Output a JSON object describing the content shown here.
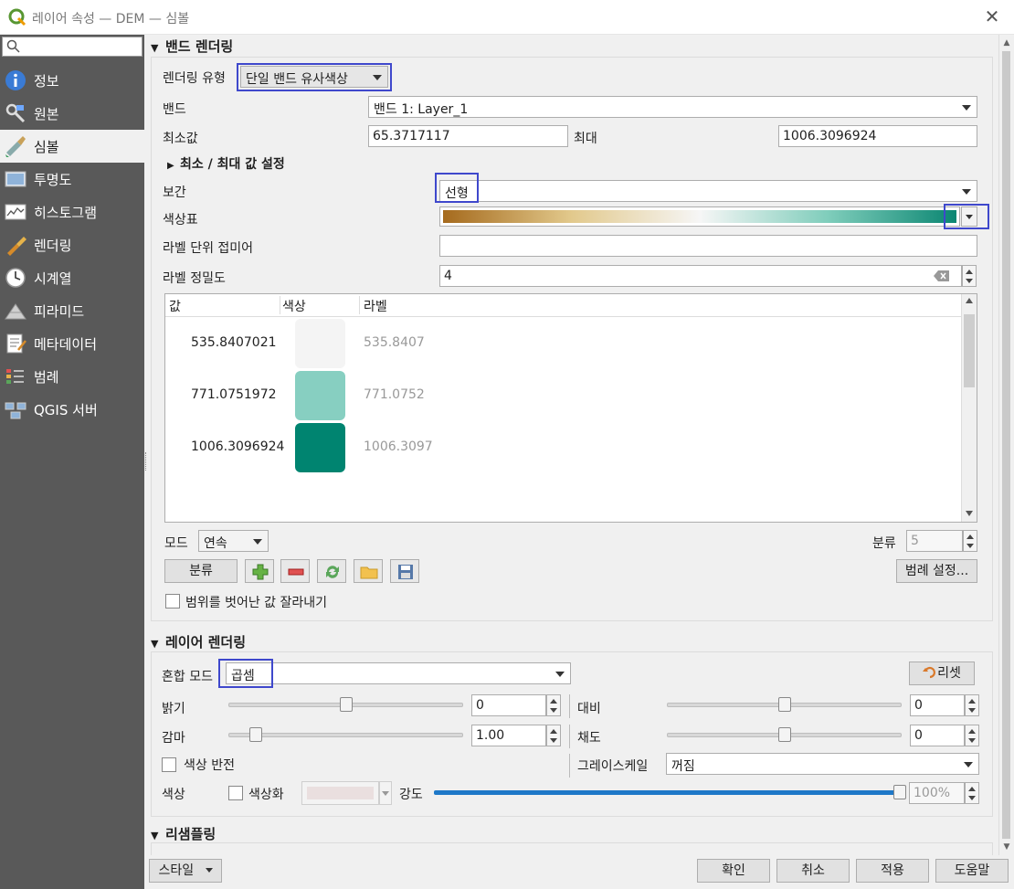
{
  "window": {
    "title": "레이어 속성 — DEM — 심볼",
    "close_glyph": "✕"
  },
  "search": {
    "placeholder": ""
  },
  "sidebar": {
    "items": [
      {
        "label": "정보",
        "icon": "info-icon"
      },
      {
        "label": "원본",
        "icon": "source-icon"
      },
      {
        "label": "심볼",
        "icon": "symbology-icon",
        "active": true
      },
      {
        "label": "투명도",
        "icon": "transparency-icon"
      },
      {
        "label": "히스토그램",
        "icon": "histogram-icon"
      },
      {
        "label": "렌더링",
        "icon": "rendering-icon"
      },
      {
        "label": "시계열",
        "icon": "temporal-icon"
      },
      {
        "label": "피라미드",
        "icon": "pyramids-icon"
      },
      {
        "label": "메타데이터",
        "icon": "metadata-icon"
      },
      {
        "label": "범례",
        "icon": "legend-icon"
      },
      {
        "label": "QGIS 서버",
        "icon": "qgis-server-icon"
      }
    ]
  },
  "band_rendering": {
    "title": "밴드 렌더링",
    "render_type_label": "렌더링 유형",
    "render_type_value": "단일 밴드 유사색상",
    "band_label": "밴드",
    "band_value": "밴드 1: Layer_1",
    "min_label": "최소값",
    "min_value": "65.3717117",
    "max_label": "최대",
    "max_value": "1006.3096924",
    "minmax_settings_label": "최소 / 최대 값 설정",
    "interp_label": "보간",
    "interp_value": "선형",
    "color_ramp_label": "색상표",
    "label_suffix_label": "라벨 단위 접미어",
    "label_suffix_value": "",
    "label_precision_label": "라벨 정밀도",
    "label_precision_value": "4",
    "table": {
      "headers": [
        "값",
        "색상",
        "라벨"
      ],
      "rows": [
        {
          "value": "535.8407021",
          "color": "#f4f4f4",
          "label": "535.8407"
        },
        {
          "value": "771.0751972",
          "color": "#87cfc1",
          "label": "771.0752"
        },
        {
          "value": "1006.3096924",
          "color": "#008470",
          "label": "1006.3097"
        }
      ]
    },
    "mode_label": "모드",
    "mode_value": "연속",
    "classes_label": "분류",
    "classes_value": "5",
    "classify_button": "분류",
    "legend_settings_button": "범례 설정...",
    "clip_label": "범위를 벗어난 값 잘라내기",
    "ramp_colors": [
      "#a56a1d",
      "#e2c98c",
      "#f6f6f6",
      "#7fcdbb",
      "#0b8672"
    ]
  },
  "layer_rendering": {
    "title": "레이어 렌더링",
    "blend_label": "혼합 모드",
    "blend_value": "곱셈",
    "reset_button": "리셋",
    "brightness_label": "밝기",
    "brightness_value": "0",
    "brightness_level": 0.5,
    "contrast_label": "대비",
    "contrast_value": "0",
    "contrast_level": 0.5,
    "gamma_label": "감마",
    "gamma_value": "1.00",
    "saturation_label": "채도",
    "saturation_value": "0",
    "saturation_level": 0.5,
    "invert_label": "색상 반전",
    "grayscale_label": "그레이스케일",
    "grayscale_value": "꺼짐",
    "color_label": "색상",
    "colorize_label": "색상화",
    "strength_label": "강도",
    "strength_value": "100%",
    "strength_level": 1.0
  },
  "resampling": {
    "title": "리샘플링"
  },
  "footer": {
    "style_button": "스타일",
    "ok_button": "확인",
    "cancel_button": "취소",
    "apply_button": "적용",
    "help_button": "도움말"
  }
}
